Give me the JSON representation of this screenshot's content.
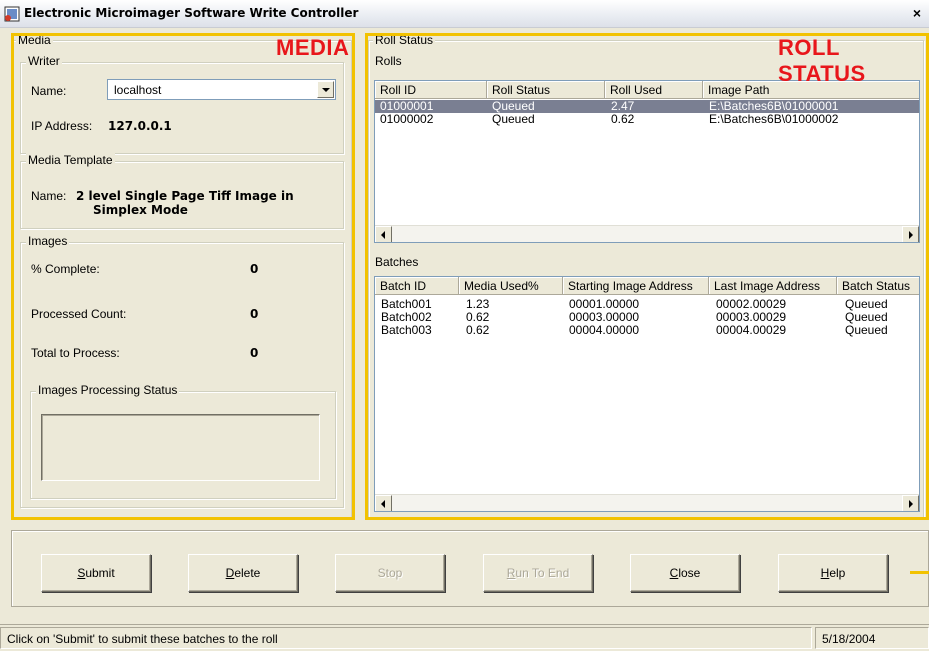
{
  "window": {
    "title": "Electronic Microimager Software Write Controller",
    "close_glyph": "×"
  },
  "annotations": {
    "media": "MEDIA",
    "roll_status": "ROLL STATUS"
  },
  "media": {
    "group_label": "Media",
    "writer": {
      "group_label": "Writer",
      "name_label": "Name:",
      "name_value": "localhost",
      "ip_label": "IP Address:",
      "ip_value": "127.0.0.1"
    },
    "template": {
      "group_label": "Media Template",
      "name_label": "Name:",
      "name_line1": "2 level Single Page Tiff Image in",
      "name_line2": "Simplex Mode"
    },
    "images": {
      "group_label": "Images",
      "rows": [
        {
          "label": "% Complete:",
          "value": "0"
        },
        {
          "label": "Processed Count:",
          "value": "0"
        },
        {
          "label": "Total to Process:",
          "value": "0"
        }
      ],
      "processing_status_label": "Images Processing Status"
    }
  },
  "roll_status": {
    "group_label": "Roll Status",
    "rolls_label": "Rolls",
    "rolls": {
      "columns": [
        "Roll ID",
        "Roll Status",
        "Roll Used",
        "Image Path"
      ],
      "rows": [
        {
          "cells": [
            "01000001",
            "Queued",
            "2.47",
            "E:\\Batches6B\\01000001"
          ],
          "selected": true
        },
        {
          "cells": [
            "01000002",
            "Queued",
            "0.62",
            "E:\\Batches6B\\01000002"
          ],
          "selected": false
        }
      ]
    },
    "batches_label": "Batches",
    "batches": {
      "columns": [
        "Batch ID",
        "Media Used%",
        "Starting Image Address",
        "Last Image Address",
        "Batch Status"
      ],
      "rows": [
        [
          "Batch001",
          "1.23",
          "00001.00000",
          "00002.00029",
          "Queued"
        ],
        [
          "Batch002",
          "0.62",
          "00003.00000",
          "00003.00029",
          "Queued"
        ],
        [
          "Batch003",
          "0.62",
          "00004.00000",
          "00004.00029",
          "Queued"
        ]
      ]
    }
  },
  "buttons": {
    "submit": {
      "mnemonic": "S",
      "rest": "ubmit",
      "enabled": true
    },
    "delete": {
      "mnemonic": "D",
      "rest": "elete",
      "enabled": true
    },
    "stop": {
      "label": "Stop",
      "enabled": false
    },
    "run_to_end": {
      "mnemonic": "R",
      "rest": "un To End",
      "enabled": false
    },
    "close": {
      "mnemonic": "C",
      "rest": "lose",
      "enabled": true
    },
    "help": {
      "mnemonic": "H",
      "rest": "elp",
      "enabled": true
    }
  },
  "statusbar": {
    "message": "Click on 'Submit' to submit these batches to the roll",
    "date": "5/18/2004"
  },
  "colors": {
    "highlight_box": "#f2c200",
    "annotation_text": "#e8161b",
    "selection": "#7a7f92"
  }
}
